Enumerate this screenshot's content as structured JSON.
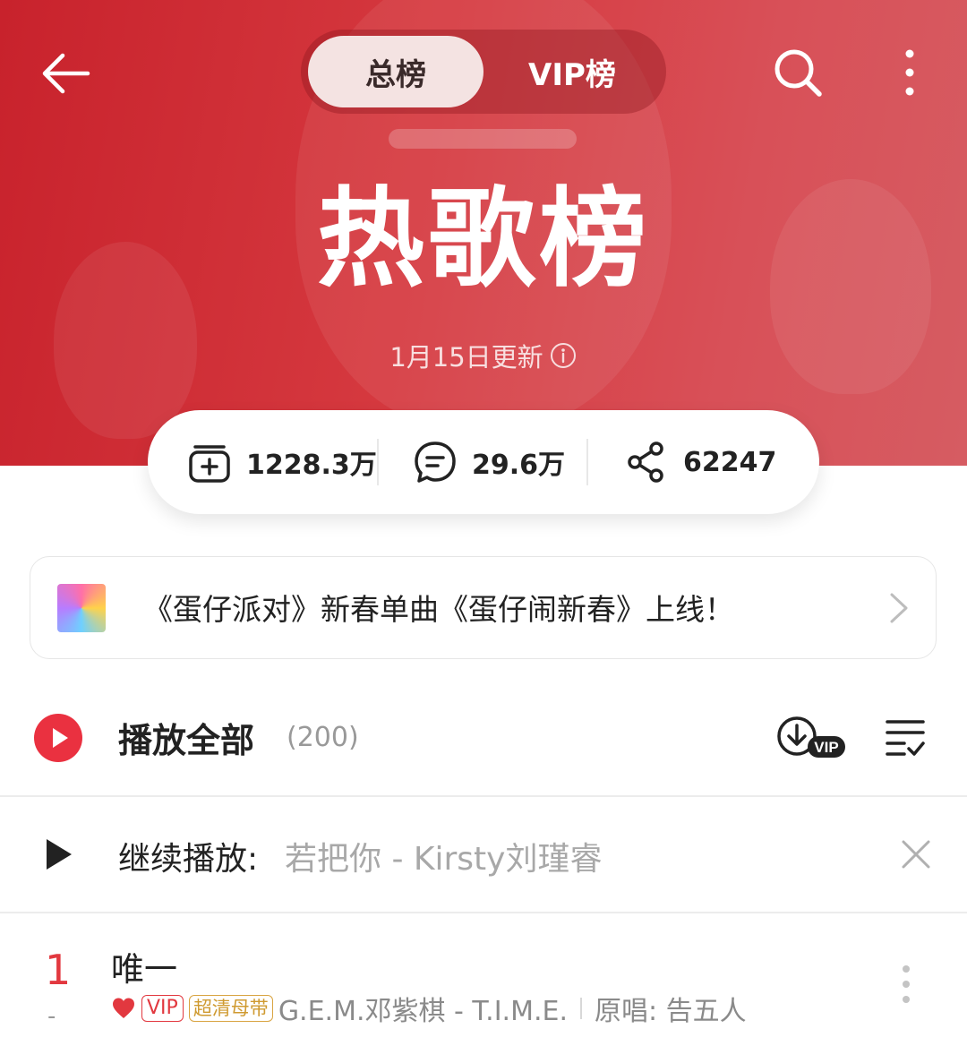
{
  "header": {
    "tabs": [
      {
        "label": "总榜",
        "active": true
      },
      {
        "label": "VIP榜",
        "active": false
      }
    ],
    "icons": [
      "back-arrow-icon",
      "search-icon",
      "more-vertical-icon"
    ]
  },
  "hero": {
    "title": "热歌榜",
    "update_text": "1月15日更新",
    "info_icon": "info-circle-icon",
    "background_color": "#d63a40"
  },
  "stats": {
    "collect": {
      "icon": "add-collection-icon",
      "value": "1228.3万"
    },
    "comment": {
      "icon": "comment-icon",
      "value": "29.6万"
    },
    "share": {
      "icon": "share-icon",
      "value": "62247"
    }
  },
  "banner": {
    "text": "《蛋仔派对》新春单曲《蛋仔闹新春》上线！",
    "icon": "chevron-right-icon"
  },
  "play_all": {
    "label": "播放全部",
    "count": "(200)",
    "download_badge": "VIP",
    "accent_color": "#ea3140"
  },
  "continue_play": {
    "label": "继续播放:",
    "song": "若把你 - Kirsty刘瑾睿"
  },
  "songs": [
    {
      "rank": "1",
      "change": "-",
      "title": "唯一",
      "vip_badge": "VIP",
      "quality_badge": "超清母带",
      "artist_album": "G.E.M.邓紫棋 - T.I.M.E.",
      "original": "原唱: 告五人"
    }
  ]
}
